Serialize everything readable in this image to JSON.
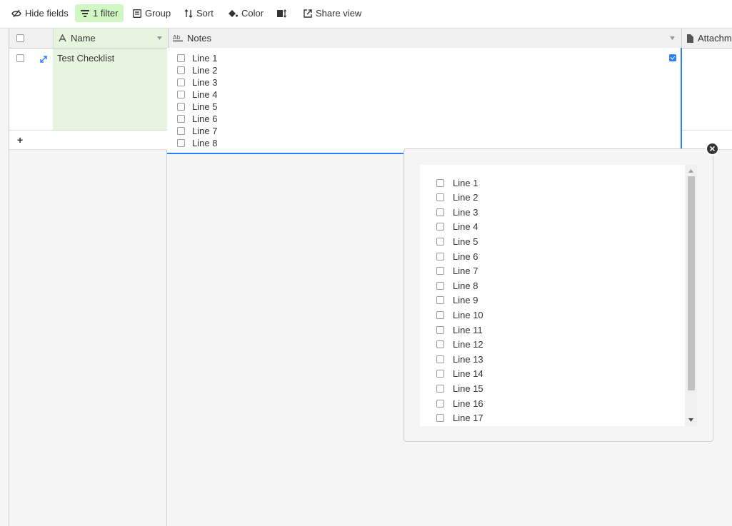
{
  "toolbar": {
    "hide_fields": "Hide fields",
    "filter": "1 filter",
    "group": "Group",
    "sort": "Sort",
    "color": "Color",
    "share_view": "Share view"
  },
  "columns": {
    "name": "Name",
    "notes": "Notes",
    "attachments": "Attachme"
  },
  "record": {
    "name": "Test Checklist",
    "notes_lines": [
      "Line 1",
      "Line 2",
      "Line 3",
      "Line 4",
      "Line 5",
      "Line 6",
      "Line 7",
      "Line 8"
    ]
  },
  "add_row_label": "+",
  "popup": {
    "lines": [
      "Line 1",
      "Line 2",
      "Line 3",
      "Line 4",
      "Line 5",
      "Line 6",
      "Line 7",
      "Line 8",
      "Line 9",
      "Line 10",
      "Line 11",
      "Line 12",
      "Line 13",
      "Line 14",
      "Line 15",
      "Line 16",
      "Line 17"
    ],
    "close_label": "×"
  },
  "colors": {
    "accent": "#2d7ff9",
    "filter_bg": "#d1f7c4",
    "name_cell_bg": "#e7f4e0"
  }
}
